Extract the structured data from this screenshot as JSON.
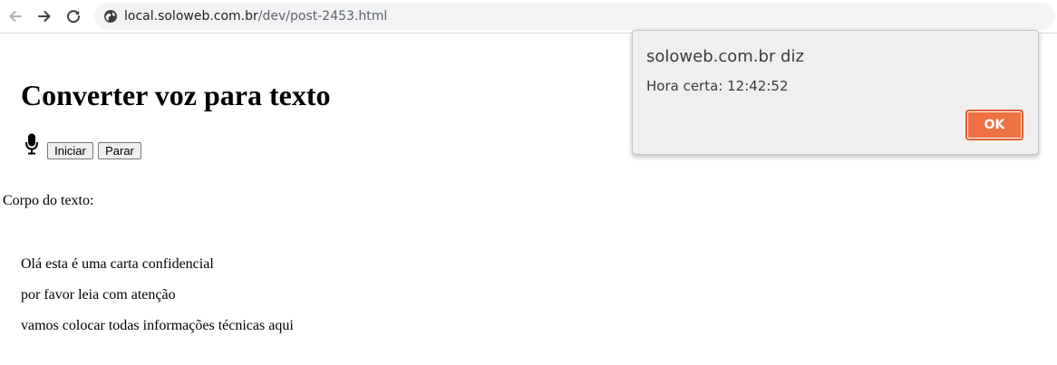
{
  "browser": {
    "url_host": "local.soloweb.com.br",
    "url_path": "/dev/post-2453.html",
    "icons": {
      "back": "arrow-left-icon",
      "forward": "arrow-right-icon",
      "reload": "reload-icon",
      "site_info": "globe-icon"
    }
  },
  "page": {
    "title": "Converter voz para texto",
    "mic_icon": "microphone-icon",
    "start_button": "Iniciar",
    "stop_button": "Parar",
    "body_label": "Corpo do texto:",
    "lines": [
      "Olá esta é uma carta confidencial",
      "por favor leia com atenção",
      "vamos colocar todas informações técnicas aqui"
    ]
  },
  "dialog": {
    "title": "soloweb.com.br diz",
    "message": "Hora certa: 12:42:52",
    "ok_label": "OK",
    "accent_color": "#ef7244"
  }
}
